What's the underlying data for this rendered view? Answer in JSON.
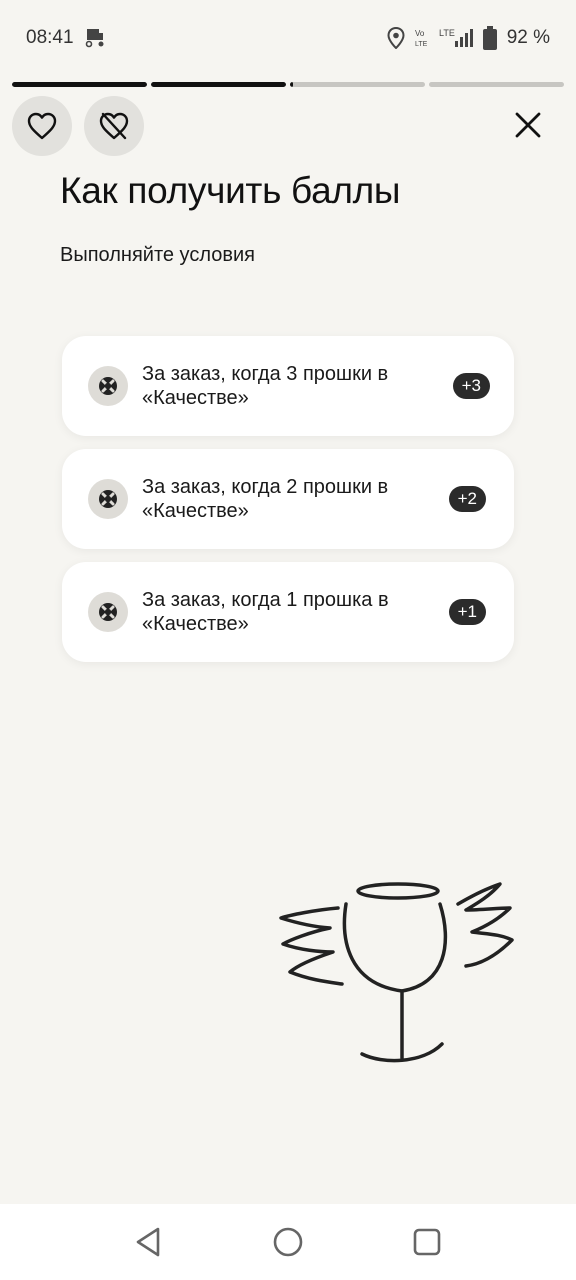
{
  "status": {
    "time": "08:41",
    "battery": "92 %",
    "network_label": "LTE"
  },
  "progress": {
    "segments": [
      1,
      1,
      0.02,
      0
    ]
  },
  "header": {
    "like_icon": "heart-icon",
    "dislike_icon": "heart-crossed-icon",
    "close_icon": "close-icon"
  },
  "main": {
    "title": "Как получить баллы",
    "subtitle": "Выполняйте условия",
    "conditions": [
      {
        "text": "За заказ, когда 3 прошки в «Качестве»",
        "points": "+3",
        "icon": "quality-icon"
      },
      {
        "text": "За заказ, когда 2 прошки в «Качестве»",
        "points": "+2",
        "icon": "quality-icon"
      },
      {
        "text": "За заказ, когда 1 прошка в «Качестве»",
        "points": "+1",
        "icon": "quality-icon"
      }
    ]
  },
  "illustration": {
    "icon": "winged-cup-illustration"
  },
  "nav": {
    "back_icon": "back-icon",
    "home_icon": "home-icon",
    "recents_icon": "recents-icon"
  },
  "colors": {
    "background": "#f6f5f1",
    "card": "#ffffff",
    "badge": "#2b2b2b",
    "accent": "#111111"
  }
}
